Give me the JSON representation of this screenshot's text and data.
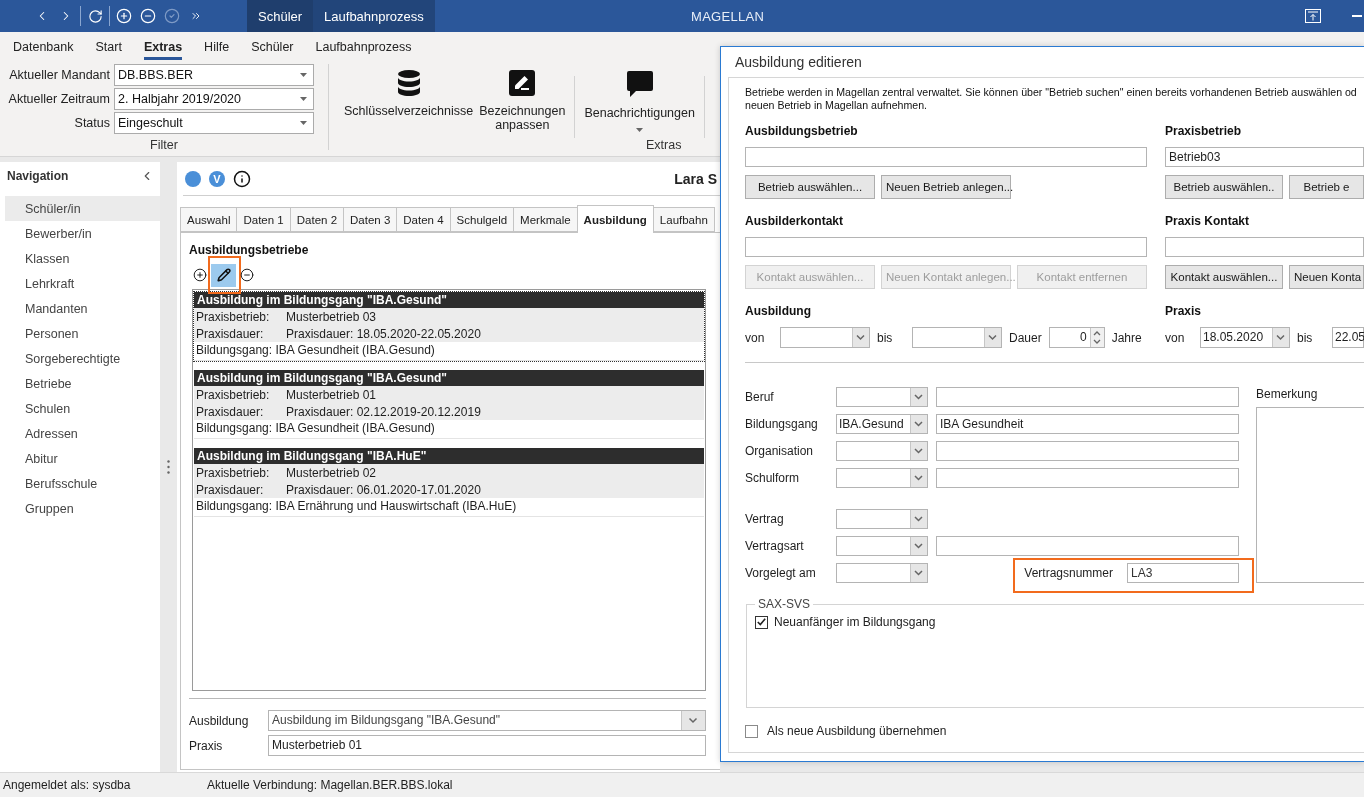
{
  "title_bar": {
    "quick_access_groups": [
      {
        "items": [
          {
            "kind": "back",
            "disabled": false
          },
          {
            "kind": "forward",
            "disabled": false
          }
        ]
      },
      {
        "items": [
          {
            "kind": "refresh",
            "disabled": false
          }
        ]
      },
      {
        "items": [
          {
            "kind": "add",
            "disabled": false
          },
          {
            "kind": "remove",
            "disabled": false
          },
          {
            "kind": "confirm",
            "disabled": true
          },
          {
            "kind": "more",
            "disabled": false
          }
        ]
      }
    ],
    "context_tabs": [
      {
        "label": "Schüler"
      },
      {
        "label": "Laufbahnprozess"
      }
    ],
    "title": "MAGELLAN"
  },
  "menu": [
    {
      "label": "Datenbank",
      "selected": false
    },
    {
      "label": "Start",
      "selected": false
    },
    {
      "label": "Extras",
      "selected": true
    },
    {
      "label": "Hilfe",
      "selected": false
    },
    {
      "label": "Schüler",
      "selected": false
    },
    {
      "label": "Laufbahnprozess",
      "selected": false
    }
  ],
  "ribbon": {
    "filter": {
      "fields": [
        {
          "label": "Aktueller Mandant",
          "value": "DB.BBS.BER"
        },
        {
          "label": "Aktueller Zeitraum",
          "value": "2. Halbjahr 2019/2020"
        },
        {
          "label": "Status",
          "value": "Eingeschult"
        }
      ],
      "caption": "Filter"
    },
    "extras": {
      "button_groups": [
        {
          "buttons": [
            {
              "kind": "database",
              "label": "Schlüsselverzeichnisse",
              "has_menu": false
            },
            {
              "kind": "edit",
              "label": "Bezeichnungen anpassen",
              "has_menu": false
            }
          ]
        },
        {
          "buttons": [
            {
              "kind": "message",
              "label": "Benachrichtigungen",
              "has_menu": true
            }
          ]
        }
      ],
      "caption": "Extras"
    }
  },
  "navigation": {
    "title": "Navigation",
    "items": [
      {
        "label": "Schüler/in",
        "selected": true
      },
      {
        "label": "Bewerber/in",
        "selected": false
      },
      {
        "label": "Klassen",
        "selected": false
      },
      {
        "label": "Lehrkraft",
        "selected": false
      },
      {
        "label": "Mandanten",
        "selected": false
      },
      {
        "label": "Personen",
        "selected": false
      },
      {
        "label": "Sorgeberechtigte",
        "selected": false
      },
      {
        "label": "Betriebe",
        "selected": false
      },
      {
        "label": "Schulen",
        "selected": false
      },
      {
        "label": "Adressen",
        "selected": false
      },
      {
        "label": "Abitur",
        "selected": false
      },
      {
        "label": "Berufsschule",
        "selected": false
      },
      {
        "label": "Gruppen",
        "selected": false
      }
    ]
  },
  "record": {
    "badge": "V",
    "name": "Lara S"
  },
  "tabs": [
    {
      "label": "Auswahl",
      "selected": false
    },
    {
      "label": "Daten 1",
      "selected": false
    },
    {
      "label": "Daten 2",
      "selected": false
    },
    {
      "label": "Daten 3",
      "selected": false
    },
    {
      "label": "Daten 4",
      "selected": false
    },
    {
      "label": "Schulgeld",
      "selected": false
    },
    {
      "label": "Merkmale",
      "selected": false
    },
    {
      "label": "Ausbildung",
      "selected": true
    },
    {
      "label": "Laufbahn",
      "selected": false
    }
  ],
  "training_companies": {
    "title": "Ausbildungsbetriebe",
    "toolbar": [
      {
        "kind": "add",
        "selected": false,
        "highlighted": false
      },
      {
        "kind": "edit",
        "selected": true,
        "highlighted": true
      },
      {
        "kind": "remove",
        "selected": false,
        "highlighted": false
      }
    ],
    "entries": [
      {
        "title": "Ausbildung im Bildungsgang \"IBA.Gesund\"",
        "selected": true,
        "details": [
          {
            "label": "Praxisbetrieb:",
            "value": "Musterbetrieb 03"
          },
          {
            "label": "Praxisdauer:",
            "value": "Praxisdauer: 18.05.2020-22.05.2020"
          }
        ],
        "course": "Bildungsgang: IBA Gesundheit (IBA.Gesund)"
      },
      {
        "title": "Ausbildung im Bildungsgang \"IBA.Gesund\"",
        "selected": false,
        "details": [
          {
            "label": "Praxisbetrieb:",
            "value": "Musterbetrieb 01"
          },
          {
            "label": "Praxisdauer:",
            "value": "Praxisdauer: 02.12.2019-20.12.2019"
          }
        ],
        "course": "Bildungsgang: IBA Gesundheit (IBA.Gesund)"
      },
      {
        "title": "Ausbildung im Bildungsgang \"IBA.HuE\"",
        "selected": false,
        "details": [
          {
            "label": "Praxisbetrieb:",
            "value": "Musterbetrieb 02"
          },
          {
            "label": "Praxisdauer:",
            "value": "Praxisdauer: 06.01.2020-17.01.2020"
          }
        ],
        "course": "Bildungsgang: IBA Ernährung und Hauswirtschaft (IBA.HuE)"
      }
    ]
  },
  "selection_fields": [
    {
      "label": "Ausbildung",
      "kind": "combo",
      "value": "Ausbildung im Bildungsgang \"IBA.Gesund\""
    },
    {
      "label": "Praxis",
      "kind": "text",
      "value": "Musterbetrieb 01"
    }
  ],
  "status_bar": {
    "user": "Angemeldet als: sysdba",
    "connection": "Aktuelle Verbindung: Magellan.BER.BBS.lokal"
  },
  "dialog": {
    "title": "Ausbildung editieren",
    "description_lines": [
      "Betriebe werden in Magellan zentral verwaltet. Sie können über \"Betrieb suchen\" einen bereits vorhandenen Betrieb auswählen od",
      "neuen Betrieb in Magellan aufnehmen."
    ],
    "sections": [
      {
        "kind": "picker",
        "columns": [
          {
            "title": "Ausbildungsbetrieb",
            "buttons": [
              {
                "label": "Betrieb auswählen...",
                "disabled": false
              },
              {
                "label": "Neuen Betrieb anlegen...",
                "disabled": false
              }
            ]
          },
          {
            "title": "Praxisbetrieb",
            "value": "Betrieb03",
            "buttons": [
              {
                "label": "Betrieb auswählen..",
                "disabled": false
              },
              {
                "label": "Betrieb e",
                "disabled": false
              }
            ]
          }
        ]
      },
      {
        "kind": "picker",
        "columns": [
          {
            "title": "Ausbilderkontakt",
            "buttons": [
              {
                "label": "Kontakt auswählen...",
                "disabled": true
              },
              {
                "label": "Neuen Kontakt anlegen...",
                "disabled": true
              },
              {
                "label": "Kontakt entfernen",
                "disabled": true
              }
            ]
          },
          {
            "title": "Praxis Kontakt",
            "buttons": [
              {
                "label": "Kontakt auswählen...",
                "disabled": false
              },
              {
                "label": "Neuen Konta",
                "disabled": false
              }
            ]
          }
        ]
      },
      {
        "kind": "period",
        "columns": [
          {
            "title": "Ausbildung",
            "fields": [
              {
                "kind": "label",
                "text": "von"
              },
              {
                "kind": "date"
              },
              {
                "kind": "label",
                "text": "bis"
              },
              {
                "kind": "date"
              },
              {
                "kind": "label",
                "text": "Dauer"
              },
              {
                "kind": "spinner",
                "value": "0"
              },
              {
                "kind": "label",
                "text": "Jahre"
              }
            ]
          },
          {
            "title": "Praxis",
            "fields": [
              {
                "kind": "label",
                "text": "von"
              },
              {
                "kind": "date",
                "value": "18.05.2020"
              },
              {
                "kind": "label",
                "text": "bis"
              },
              {
                "kind": "text",
                "value": "22.05"
              }
            ]
          }
        ]
      }
    ],
    "form_groups": [
      {
        "rows": [
          {
            "label": "Beruf",
            "kind": "combo_text"
          },
          {
            "label": "Bildungsgang",
            "kind": "combo_text",
            "code": "IBA.Gesund",
            "text": "IBA Gesundheit"
          },
          {
            "label": "Organisation",
            "kind": "combo_text"
          },
          {
            "label": "Schulform",
            "kind": "combo_text"
          }
        ]
      },
      {
        "rows": [
          {
            "label": "Vertrag",
            "kind": "combo"
          },
          {
            "label": "Vertragsart",
            "kind": "combo_text"
          },
          {
            "label": "Vorgelegt am",
            "kind": "combo_number",
            "number": {
              "label": "Vertragsnummer",
              "value": "LA3",
              "highlighted": true
            }
          }
        ]
      }
    ],
    "remark": {
      "label": "Bemerkung"
    },
    "sax_svs": {
      "title": "SAX-SVS",
      "options": [
        {
          "label": "Neuanfänger im Bildungsgang",
          "checked": true
        }
      ]
    },
    "adopt": {
      "label": "Als neue Ausbildung übernehmen",
      "checked": false
    }
  }
}
